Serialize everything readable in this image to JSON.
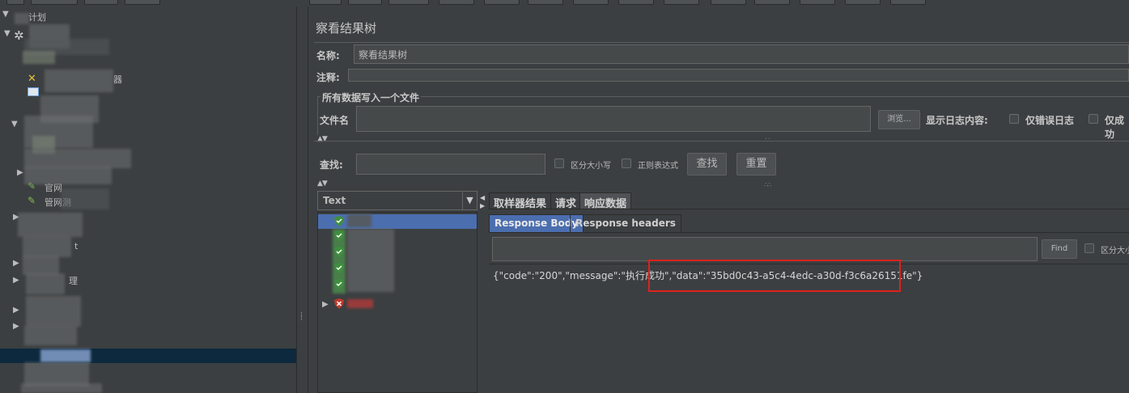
{
  "window": {
    "title": "察看结果树"
  },
  "form": {
    "name_label": "名称:",
    "name_value": "察看结果树",
    "comment_label": "注释:",
    "comment_value": "",
    "group_title": "所有数据写入一个文件",
    "filename_label": "文件名",
    "filename_value": "",
    "browse_label": "浏览...",
    "log_label": "显示日志内容:",
    "errors_only_label": "仅错误日志",
    "success_only_label": "仅成功"
  },
  "search": {
    "label": "查找:",
    "value": "",
    "case_label": "区分大小写",
    "regex_label": "正则表达式",
    "find_button": "查找",
    "reset_button": "重置"
  },
  "renderer": {
    "selected": "Text"
  },
  "result_tabs": [
    {
      "label": "取样器结果"
    },
    {
      "label": "请求"
    },
    {
      "label": "响应数据"
    }
  ],
  "response_tabs": [
    {
      "label": "Response Body"
    },
    {
      "label": "Response headers"
    }
  ],
  "response_find": {
    "value": "",
    "find_button": "Find",
    "case_label": "区分大小"
  },
  "response_body": "{\"code\":\"200\",\"message\":\"执行成功\",\"data\":\"35bd0c43-a5c4-4edc-a30d-f3c6a26151fe\"}",
  "tree": {
    "root_label": "计划",
    "items": [
      {
        "label": "器"
      },
      {
        "label": "官网"
      },
      {
        "label": "管网测"
      },
      {
        "label": "t"
      },
      {
        "label": "理"
      }
    ]
  },
  "colors": {
    "background": "#3c3f41",
    "selection": "#4b6eaf",
    "highlight_box": "#e0201c",
    "success": "#3f8f3f",
    "failure": "#c0392b"
  }
}
